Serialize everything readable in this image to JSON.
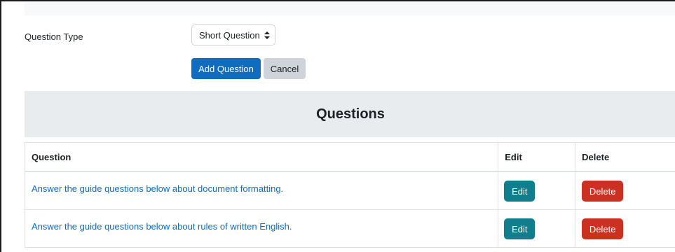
{
  "form": {
    "question_type_label": "Question Type",
    "question_type_value": "Short Question",
    "add_question_label": "Add Question",
    "cancel_label": "Cancel"
  },
  "questions_section": {
    "title": "Questions",
    "columns": [
      "Question",
      "Edit",
      "Delete"
    ],
    "rows": [
      {
        "question": "Answer the guide questions below about document formatting.",
        "edit": "Edit",
        "delete": "Delete"
      },
      {
        "question": "Answer the guide questions below about rules of written English.",
        "edit": "Edit",
        "delete": "Delete"
      }
    ]
  },
  "colors": {
    "primary": "#0f6cbf",
    "edit_button": "#117e8e",
    "delete_button": "#ca3120",
    "header_background": "#e9ecef"
  },
  "icons": {
    "select_caret": "sort-arrows-icon"
  }
}
